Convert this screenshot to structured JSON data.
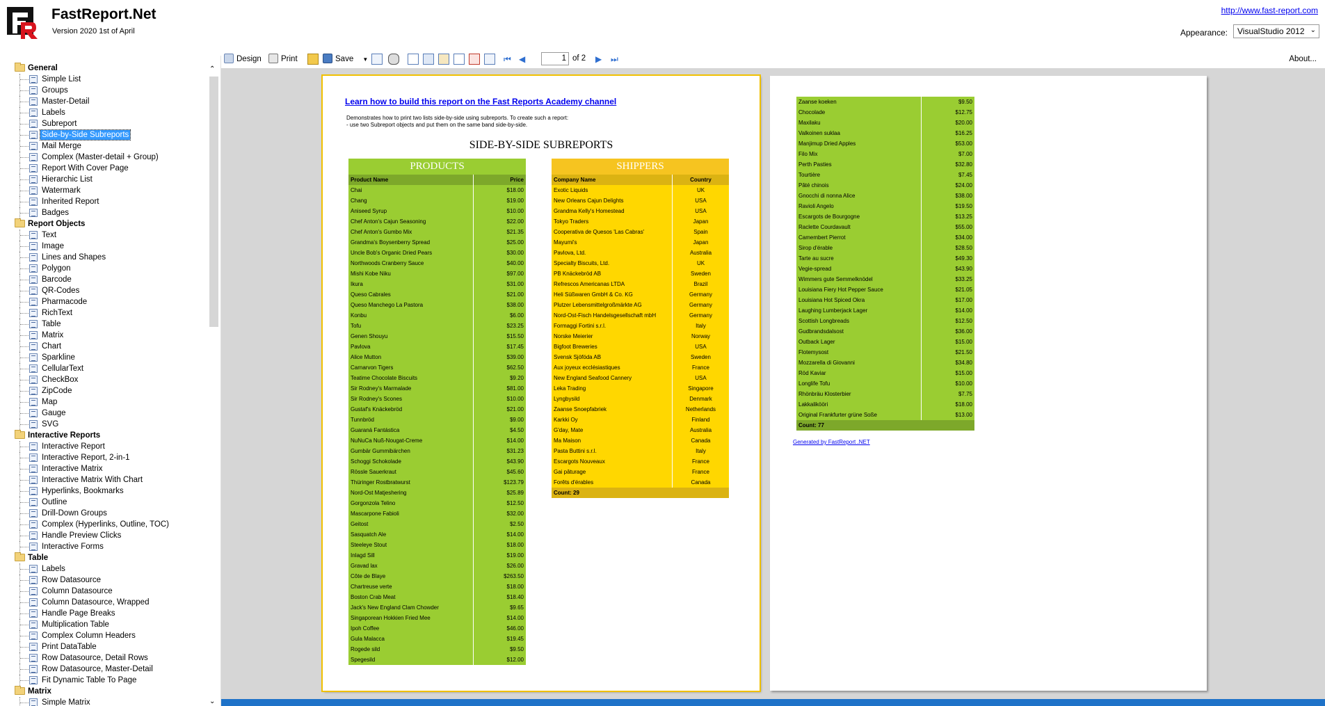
{
  "header": {
    "title": "FastReport.Net",
    "version": "Version 2020 1st of April",
    "site_link": "http://www.fast-report.com",
    "appearance_label": "Appearance:",
    "appearance_value": "VisualStudio 2012"
  },
  "sidebar": {
    "groups": [
      {
        "label": "General",
        "items": [
          "Simple List",
          "Groups",
          "Master-Detail",
          "Labels",
          "Subreport",
          "Side-by-Side Subreports",
          "Mail Merge",
          "Complex (Master-detail + Group)",
          "Report With Cover Page",
          "Hierarchic List",
          "Watermark",
          "Inherited Report",
          "Badges"
        ]
      },
      {
        "label": "Report Objects",
        "items": [
          "Text",
          "Image",
          "Lines and Shapes",
          "Polygon",
          "Barcode",
          "QR-Codes",
          "Pharmacode",
          "RichText",
          "Table",
          "Matrix",
          "Chart",
          "Sparkline",
          "CellularText",
          "CheckBox",
          "ZipCode",
          "Map",
          "Gauge",
          "SVG"
        ]
      },
      {
        "label": "Interactive Reports",
        "items": [
          "Interactive Report",
          "Interactive Report, 2-in-1",
          "Interactive Matrix",
          "Interactive Matrix With Chart",
          "Hyperlinks, Bookmarks",
          "Outline",
          "Drill-Down Groups",
          "Complex (Hyperlinks, Outline, TOC)",
          "Handle Preview Clicks",
          "Interactive Forms"
        ]
      },
      {
        "label": "Table",
        "items": [
          "Labels",
          "Row Datasource",
          "Column Datasource",
          "Column Datasource, Wrapped",
          "Handle Page Breaks",
          "Multiplication Table",
          "Complex Column Headers",
          "Print DataTable",
          "Row Datasource, Detail Rows",
          "Row Datasource, Master-Detail",
          "Fit Dynamic Table To Page"
        ]
      },
      {
        "label": "Matrix",
        "items": [
          "Simple Matrix"
        ]
      }
    ],
    "selected": "Side-by-Side Subreports"
  },
  "toolbar": {
    "design": "Design",
    "print": "Print",
    "save": "Save",
    "page_current": "1",
    "page_of": "of 2",
    "about": "About..."
  },
  "report": {
    "academy_link": "Learn how to build this report on the Fast Reports Academy channel",
    "desc_line1": "Demonstrates how to print two lists side-by-side using subreports. To create such a report:",
    "desc_line2": "- use two Subreport objects and put them on the same band side-by-side.",
    "title": "SIDE-BY-SIDE SUBREPORTS",
    "products": {
      "title": "PRODUCTS",
      "col1": "Product Name",
      "col2": "Price",
      "rows_page1": [
        [
          "Chai",
          "$18.00"
        ],
        [
          "Chang",
          "$19.00"
        ],
        [
          "Aniseed Syrup",
          "$10.00"
        ],
        [
          "Chef Anton's Cajun Seasoning",
          "$22.00"
        ],
        [
          "Chef Anton's Gumbo Mix",
          "$21.35"
        ],
        [
          "Grandma's Boysenberry Spread",
          "$25.00"
        ],
        [
          "Uncle Bob's Organic Dried Pears",
          "$30.00"
        ],
        [
          "Northwoods Cranberry Sauce",
          "$40.00"
        ],
        [
          "Mishi Kobe Niku",
          "$97.00"
        ],
        [
          "Ikura",
          "$31.00"
        ],
        [
          "Queso Cabrales",
          "$21.00"
        ],
        [
          "Queso Manchego La Pastora",
          "$38.00"
        ],
        [
          "Konbu",
          "$6.00"
        ],
        [
          "Tofu",
          "$23.25"
        ],
        [
          "Genen Shouyu",
          "$15.50"
        ],
        [
          "Pavlova",
          "$17.45"
        ],
        [
          "Alice Mutton",
          "$39.00"
        ],
        [
          "Carnarvon Tigers",
          "$62.50"
        ],
        [
          "Teatime Chocolate Biscuits",
          "$9.20"
        ],
        [
          "Sir Rodney's Marmalade",
          "$81.00"
        ],
        [
          "Sir Rodney's Scones",
          "$10.00"
        ],
        [
          "Gustaf's Knäckebröd",
          "$21.00"
        ],
        [
          "Tunnbröd",
          "$9.00"
        ],
        [
          "Guaraná Fantástica",
          "$4.50"
        ],
        [
          "NuNuCa Nuß-Nougat-Creme",
          "$14.00"
        ],
        [
          "Gumbär Gummibärchen",
          "$31.23"
        ],
        [
          "Schoggi Schokolade",
          "$43.90"
        ],
        [
          "Rössle Sauerkraut",
          "$45.60"
        ],
        [
          "Thüringer Rostbratwurst",
          "$123.79"
        ],
        [
          "Nord-Ost Matjeshering",
          "$25.89"
        ],
        [
          "Gorgonzola Telino",
          "$12.50"
        ],
        [
          "Mascarpone Fabioli",
          "$32.00"
        ],
        [
          "Geitost",
          "$2.50"
        ],
        [
          "Sasquatch Ale",
          "$14.00"
        ],
        [
          "Steeleye Stout",
          "$18.00"
        ],
        [
          "Inlagd Sill",
          "$19.00"
        ],
        [
          "Gravad lax",
          "$26.00"
        ],
        [
          "Côte de Blaye",
          "$263.50"
        ],
        [
          "Chartreuse verte",
          "$18.00"
        ],
        [
          "Boston Crab Meat",
          "$18.40"
        ],
        [
          "Jack's New England Clam Chowder",
          "$9.65"
        ],
        [
          "Singaporean Hokkien Fried Mee",
          "$14.00"
        ],
        [
          "Ipoh Coffee",
          "$46.00"
        ],
        [
          "Gula Malacca",
          "$19.45"
        ],
        [
          "Rogede sild",
          "$9.50"
        ],
        [
          "Spegesild",
          "$12.00"
        ]
      ],
      "rows_page2": [
        [
          "Zaanse koeken",
          "$9.50"
        ],
        [
          "Chocolade",
          "$12.75"
        ],
        [
          "Maxilaku",
          "$20.00"
        ],
        [
          "Valkoinen suklaa",
          "$16.25"
        ],
        [
          "Manjimup Dried Apples",
          "$53.00"
        ],
        [
          "Filo Mix",
          "$7.00"
        ],
        [
          "Perth Pasties",
          "$32.80"
        ],
        [
          "Tourtière",
          "$7.45"
        ],
        [
          "Pâté chinois",
          "$24.00"
        ],
        [
          "Gnocchi di nonna Alice",
          "$38.00"
        ],
        [
          "Ravioli Angelo",
          "$19.50"
        ],
        [
          "Escargots de Bourgogne",
          "$13.25"
        ],
        [
          "Raclette Courdavault",
          "$55.00"
        ],
        [
          "Camembert Pierrot",
          "$34.00"
        ],
        [
          "Sirop d'érable",
          "$28.50"
        ],
        [
          "Tarte au sucre",
          "$49.30"
        ],
        [
          "Vegie-spread",
          "$43.90"
        ],
        [
          "Wimmers gute Semmelknödel",
          "$33.25"
        ],
        [
          "Louisiana Fiery Hot Pepper Sauce",
          "$21.05"
        ],
        [
          "Louisiana Hot Spiced Okra",
          "$17.00"
        ],
        [
          "Laughing Lumberjack Lager",
          "$14.00"
        ],
        [
          "Scottish Longbreads",
          "$12.50"
        ],
        [
          "Gudbrandsdalsost",
          "$36.00"
        ],
        [
          "Outback Lager",
          "$15.00"
        ],
        [
          "Flotemysost",
          "$21.50"
        ],
        [
          "Mozzarella di Giovanni",
          "$34.80"
        ],
        [
          "Röd Kaviar",
          "$15.00"
        ],
        [
          "Longlife Tofu",
          "$10.00"
        ],
        [
          "Rhönbräu Klosterbier",
          "$7.75"
        ],
        [
          "Lakkalikööri",
          "$18.00"
        ],
        [
          "Original Frankfurter grüne Soße",
          "$13.00"
        ]
      ],
      "count": "Count: 77"
    },
    "shippers": {
      "title": "SHIPPERS",
      "col1": "Company Name",
      "col2": "Country",
      "rows": [
        [
          "Exotic Liquids",
          "UK"
        ],
        [
          "New Orleans Cajun Delights",
          "USA"
        ],
        [
          "Grandma Kelly's Homestead",
          "USA"
        ],
        [
          "Tokyo Traders",
          "Japan"
        ],
        [
          "Cooperativa de Quesos 'Las Cabras'",
          "Spain"
        ],
        [
          "Mayumi's",
          "Japan"
        ],
        [
          "Pavlova, Ltd.",
          "Australia"
        ],
        [
          "Specialty Biscuits, Ltd.",
          "UK"
        ],
        [
          "PB Knäckebröd AB",
          "Sweden"
        ],
        [
          "Refrescos Americanas LTDA",
          "Brazil"
        ],
        [
          "Heli Süßwaren GmbH & Co. KG",
          "Germany"
        ],
        [
          "Plutzer Lebensmittelgroßmärkte AG",
          "Germany"
        ],
        [
          "Nord-Ost-Fisch Handelsgesellschaft mbH",
          "Germany"
        ],
        [
          "Formaggi Fortini s.r.l.",
          "Italy"
        ],
        [
          "Norske Meierier",
          "Norway"
        ],
        [
          "Bigfoot Breweries",
          "USA"
        ],
        [
          "Svensk Sjöföda AB",
          "Sweden"
        ],
        [
          "Aux joyeux ecclésiastiques",
          "France"
        ],
        [
          "New England Seafood Cannery",
          "USA"
        ],
        [
          "Leka Trading",
          "Singapore"
        ],
        [
          "Lyngbysild",
          "Denmark"
        ],
        [
          "Zaanse Snoepfabriek",
          "Netherlands"
        ],
        [
          "Karkki Oy",
          "Finland"
        ],
        [
          "G'day, Mate",
          "Australia"
        ],
        [
          "Ma Maison",
          "Canada"
        ],
        [
          "Pasta Buttini s.r.l.",
          "Italy"
        ],
        [
          "Escargots Nouveaux",
          "France"
        ],
        [
          "Gai pâturage",
          "France"
        ],
        [
          "Forêts d'érables",
          "Canada"
        ]
      ],
      "count": "Count: 29"
    },
    "generated": "Generated by FastReport .NET"
  },
  "colors": {
    "products_bg": "#9acd32",
    "shippers_bg": "#ffd700",
    "selection": "#3399ff",
    "preview_bg": "#d6d6d6"
  }
}
